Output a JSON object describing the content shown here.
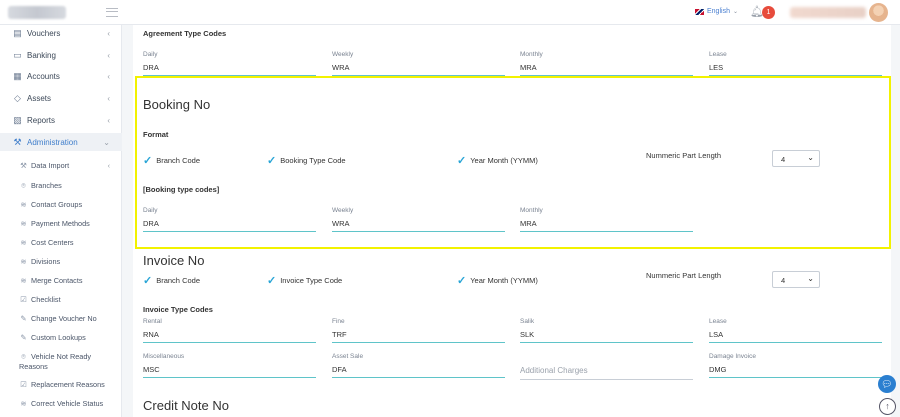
{
  "header": {
    "language": "English",
    "notification_count": "1"
  },
  "sidebar": {
    "items": [
      {
        "label": "Vouchers",
        "icon": "voucher-icon"
      },
      {
        "label": "Banking",
        "icon": "bank-icon"
      },
      {
        "label": "Accounts",
        "icon": "accounts-icon"
      },
      {
        "label": "Assets",
        "icon": "diamond-icon"
      },
      {
        "label": "Reports",
        "icon": "reports-icon"
      },
      {
        "label": "Administration",
        "icon": "wrench-icon"
      }
    ],
    "sub_items": [
      "Data Import",
      "Branches",
      "Contact Groups",
      "Payment Methods",
      "Cost Centers",
      "Divisions",
      "Merge Contacts",
      "Checklist",
      "Change Voucher No",
      "Custom Lookups",
      "Vehicle Not Ready Reasons",
      "Replacement Reasons",
      "Correct Vehicle Status"
    ]
  },
  "agreement": {
    "heading": "Agreement Type Codes",
    "fields": [
      {
        "label": "Daily",
        "value": "DRA"
      },
      {
        "label": "Weekly",
        "value": "WRA"
      },
      {
        "label": "Monthly",
        "value": "MRA"
      },
      {
        "label": "Lease",
        "value": "LES"
      }
    ]
  },
  "booking": {
    "title": "Booking No",
    "format_label": "Format",
    "checks": [
      "Branch Code",
      "Booking Type Code",
      "Year Month (YYMM)"
    ],
    "numeric_label": "Nummeric Part Length",
    "numeric_value": "4",
    "codes_heading": "[Booking type codes]",
    "fields": [
      {
        "label": "Daily",
        "value": "DRA"
      },
      {
        "label": "Weekly",
        "value": "WRA"
      },
      {
        "label": "Monthly",
        "value": "MRA"
      }
    ]
  },
  "invoice": {
    "title": "Invoice No",
    "checks": [
      "Branch Code",
      "Invoice Type Code",
      "Year Month (YYMM)"
    ],
    "numeric_label": "Nummeric Part Length",
    "numeric_value": "4",
    "codes_heading": "Invoice Type Codes",
    "fields": [
      {
        "label": "Rental",
        "value": "RNA"
      },
      {
        "label": "Fine",
        "value": "TRF"
      },
      {
        "label": "Salik",
        "value": "SLK"
      },
      {
        "label": "Lease",
        "value": "LSA"
      },
      {
        "label": "Miscellaneous",
        "value": "MSC"
      },
      {
        "label": "Asset Sale",
        "value": "DFA"
      },
      {
        "label": "",
        "value": "",
        "placeholder": "Additional Charges"
      },
      {
        "label": "Damage Invoice",
        "value": "DMG"
      }
    ]
  },
  "credit_note": {
    "title": "Credit Note No"
  },
  "colors": {
    "accent": "#3f7ecb",
    "underline": "#5fc4c9",
    "highlight": "#f2f200",
    "badge": "#e74c3c"
  }
}
